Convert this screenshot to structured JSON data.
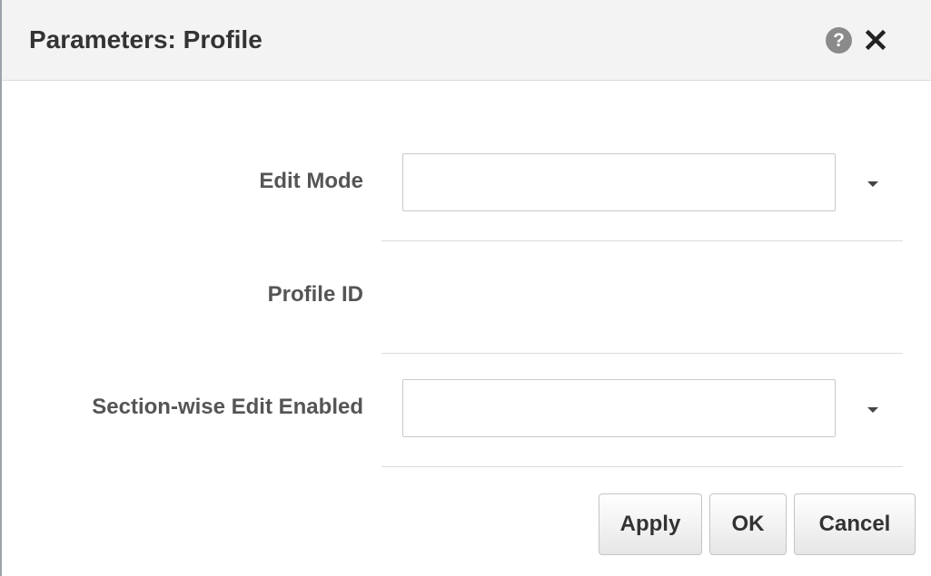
{
  "dialog": {
    "title": "Parameters: Profile",
    "help_icon": "question-mark-icon",
    "help_glyph": "?",
    "close_icon": "close-icon"
  },
  "form": {
    "fields": [
      {
        "label": "Edit Mode",
        "value": "",
        "type": "select"
      },
      {
        "label": "Profile ID",
        "value": "",
        "type": "text"
      },
      {
        "label": "Section-wise Edit Enabled",
        "value": "",
        "type": "select"
      }
    ]
  },
  "buttons": {
    "apply": "Apply",
    "ok": "OK",
    "cancel": "Cancel"
  },
  "colors": {
    "title_bar": "#f3f3f3",
    "label_text": "#555555",
    "icon_gray": "#8a8a8a"
  }
}
